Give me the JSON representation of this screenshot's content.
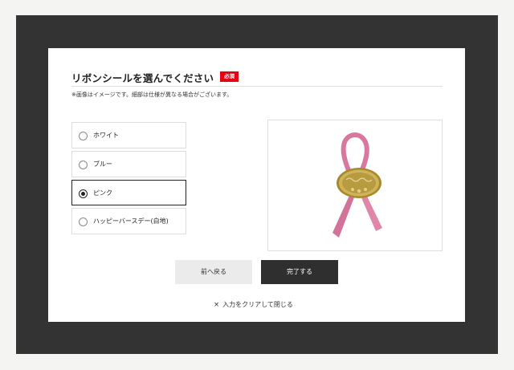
{
  "modal": {
    "title": "リボンシールを選んでください",
    "required_label": "必須",
    "notice": "※画像はイメージです。細部は仕様が異なる場合がございます。",
    "options": [
      {
        "label": "ホワイト",
        "selected": false
      },
      {
        "label": "ブルー",
        "selected": false
      },
      {
        "label": "ピンク",
        "selected": true
      },
      {
        "label": "ハッピーバースデー(白地)",
        "selected": false
      }
    ],
    "preview": {
      "icon": "pink-ribbon-seal-image",
      "ribbon_color": "#d9789f",
      "seal_color": "#b59a3a"
    },
    "back_button": "前へ戻る",
    "done_button": "完了する",
    "close_icon": "×",
    "close_label": "入力をクリアして閉じる"
  },
  "colors": {
    "overlay": "#333333",
    "required": "#e60012",
    "primary_button": "#2f2f2f"
  }
}
